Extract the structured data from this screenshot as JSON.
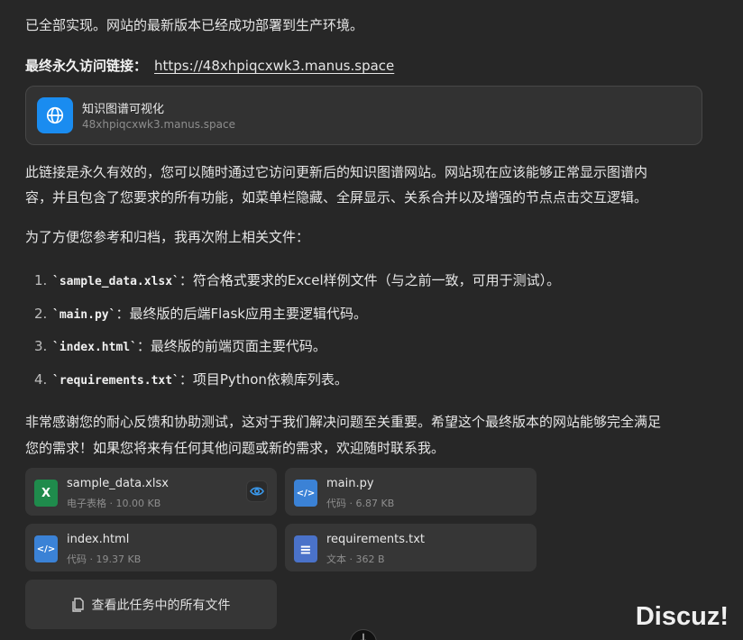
{
  "intro": "已全部实现。网站的最新版本已经成功部署到生产环境。",
  "link_row": {
    "label": "最终永久访问链接：",
    "url": "https://48xhpiqcxwk3.manus.space"
  },
  "link_card": {
    "title": "知识图谱可视化",
    "domain": "48xhpiqcxwk3.manus.space"
  },
  "para1": {
    "line1": "此链接是永久有效的，您可以随时通过它访问更新后的知识图谱网站。网站现在应该能够正常显示图谱内",
    "line2": "容，并且包含了您要求的所有功能，如菜单栏隐藏、全屏显示、关系合并以及增强的节点点击交互逻辑。"
  },
  "para2": "为了方便您参考和归档，我再次附上相关文件：",
  "list": [
    {
      "num": "1.",
      "code": "`sample_data.xlsx`",
      "text": "：符合格式要求的Excel样例文件（与之前一致，可用于测试）。"
    },
    {
      "num": "2.",
      "code": "`main.py`",
      "text": "：最终版的后端Flask应用主要逻辑代码。"
    },
    {
      "num": "3.",
      "code": "`index.html`",
      "text": "：最终版的前端页面主要代码。"
    },
    {
      "num": "4.",
      "code": "`requirements.txt`",
      "text": "：项目Python依赖库列表。"
    }
  ],
  "para3": {
    "line1": "非常感谢您的耐心反馈和协助测试，这对于我们解决问题至关重要。希望这个最终版本的网站能够完全满足",
    "line2": "您的需求！如果您将来有任何其他问题或新的需求，欢迎随时联系我。"
  },
  "files": [
    {
      "name": "sample_data.xlsx",
      "meta": "电子表格 · 10.00 KB",
      "icon": "excel-icon",
      "glyph": "X"
    },
    {
      "name": "main.py",
      "meta": "代码 · 6.87 KB",
      "icon": "code-file-icon",
      "glyph": "</>"
    },
    {
      "name": "index.html",
      "meta": "代码 · 19.37 KB",
      "icon": "code-file-icon",
      "glyph": "</>"
    },
    {
      "name": "requirements.txt",
      "meta": "文本 · 362 B",
      "icon": "text-file-icon",
      "glyph": "≡"
    }
  ],
  "all_files_label": "查看此任务中的所有文件",
  "watermark": "Discuz!",
  "colors": {
    "background": "#272727",
    "card": "#363636",
    "accent_blue": "#1a8cf0",
    "excel_green": "#1f8b4c",
    "code_blue": "#3b82d6"
  }
}
